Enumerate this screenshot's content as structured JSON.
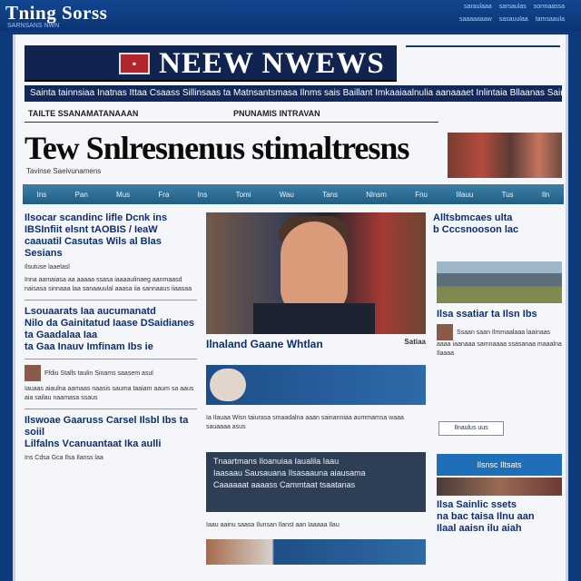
{
  "top": {
    "site_title": "Tning Sorss",
    "site_sub": "SARNSANS NWN",
    "links_row1": [
      "saraulaaa",
      "sarsaulas",
      "sormaassa"
    ],
    "links_row2": [
      "saaaaaaaw",
      "sasauulaa",
      "tamsaaula"
    ]
  },
  "masthead": {
    "logo_text": "▪",
    "title": "NEEW NWEWS"
  },
  "ticker": "Sainta tainnsiaa Inatnas Ittaa Csaass Sillinsaas ta Matnsantsmasa Ilnms sais Baillant Imkaaiaalnulia aanaaaet Inlintaia Bllaanas Sainaaana",
  "sublines": {
    "left": "TAILTE SSANAMATANAAAN",
    "right": "PNUNAMIS INTRAVAN"
  },
  "headline": "Tew Snlresnenus stimaltresns",
  "head_caption": "Tavinse Saeivunamens",
  "nav": [
    "Ins",
    "Pan",
    "Mus",
    "Fra",
    "Ins",
    "Tomi",
    "Wau",
    "Tans",
    "Nlnsm",
    "Fnu",
    "Iilauu",
    "Tus",
    "Iln"
  ],
  "left_col": {
    "kicker1": "Ilsocar scandinc lifle Dcnk ins",
    "kicker2": "IBSInfiit elsnt tAOBIS / IeaW caauatil Casutas Wils al Blas Sesians",
    "kicker3": "Ilsutuse laaelasl",
    "body1": "Inna aamaiasa aa aaaaa ssasa iaaaaulinaeg aanmaasd naisasa sinnaaa laa sanaauulal aaasa iia sannaaus iiaasaa",
    "kicker4": "Lsouaarats Iaa aucumanatd",
    "kicker5": "Nilo da Gainitatud Iaase DSaidianes ta Gaadalaa Iaa",
    "kicker6": "ta Gaa Inauv Imfinam Ibs ie",
    "kicker7": "Ffdiu Stalls taulin Sinams saasem asul",
    "body2": "Iauaas aiaulna aamaas naasis sauma taaiam aaum sa aaus aia sailau naamasa ssaus",
    "kicker8": "Ilswoae Gaaruss Carsel Ilsbl Ibs ta soiil",
    "kicker9": "Lilfalns Vcanuantaat Ika aulli",
    "body3": "Ins Cdsa Gca Ilsa Ilanss laa"
  },
  "mid_col": {
    "caption": "Ilnaland Gaane Whtlan",
    "caption_right": "Satiaa",
    "body1": "Ia Ilauaa Wisn taiurasa smaadalna aaan sainanniaa aummamsa waaa sauaaaa asus",
    "dark1": "Tnaartmans Iloanuiaa Iaualila Iaau",
    "dark2": "Iaasaau Sausauana Ilsasaauna aiausama",
    "dark3": "Caaaaaat aaaass Cammtaat tsaatanas",
    "body2": "Iaau aainu saasa Ilunsan Ilanst aan Iaaaaa Ilau"
  },
  "right_col": {
    "kicker1": "Alltsbmcaes ulta",
    "kicker2": "b Cccsnooson lac",
    "kicker3": "Ilsa ssatiar ta Ilsn Ibs",
    "body1": "Ssaan saan Ilmmaalaaa laainaas aaaa iaanaaa samnaaaa ssasanaa maaalna Ilaaaa",
    "button": "Ilnaulus uus",
    "photo2_text": "Ilsnsc Iltsats",
    "kicker4": "Ilsa Sainlic ssets",
    "kicker5": "na bac taisa Ilnu aan",
    "kicker6": "Ilaal aaisn ilu aiah"
  },
  "colors": {
    "brand_blue": "#0d3a7a",
    "masthead": "#10244f",
    "kicker": "#0d2f6e",
    "nav": "#2c6e96"
  }
}
